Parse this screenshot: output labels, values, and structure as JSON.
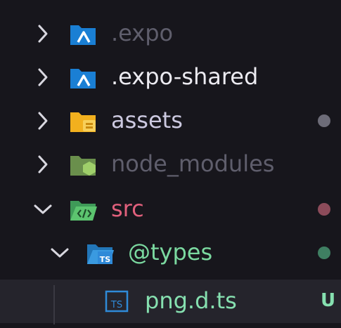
{
  "explorer": {
    "rows": [
      {
        "label": ".expo",
        "expanded": false,
        "icon": "expo-folder-icon",
        "label_color": "#5f5e6c"
      },
      {
        "label": ".expo-shared",
        "expanded": false,
        "icon": "expo-folder-icon",
        "label_color": "#ecebf1"
      },
      {
        "label": "assets",
        "expanded": false,
        "icon": "assets-folder-icon",
        "label_color": "#ccc9e0",
        "status": "dot",
        "status_color": "#6d6c78"
      },
      {
        "label": "node_modules",
        "expanded": false,
        "icon": "node-folder-icon",
        "label_color": "#5f5e6c"
      },
      {
        "label": "src",
        "expanded": true,
        "icon": "src-folder-icon",
        "label_color": "#e1607c",
        "status": "dot",
        "status_color": "#8c4b5a"
      },
      {
        "label": "@types",
        "expanded": true,
        "icon": "types-folder-icon",
        "label_color": "#7bd9a0",
        "status": "dot",
        "status_color": "#3f7f62"
      },
      {
        "label": "png.d.ts",
        "icon": "typescript-file-icon",
        "label_color": "#86e0b0",
        "status": "U",
        "status_color": "#86e0b0",
        "selected": true
      }
    ]
  },
  "colors": {
    "background": "#17161c",
    "selected_row": "#25242c",
    "chevron": "#d8d7df",
    "expo_blue": "#1a7fd4",
    "typescript_blue": "#2f8ad8"
  }
}
